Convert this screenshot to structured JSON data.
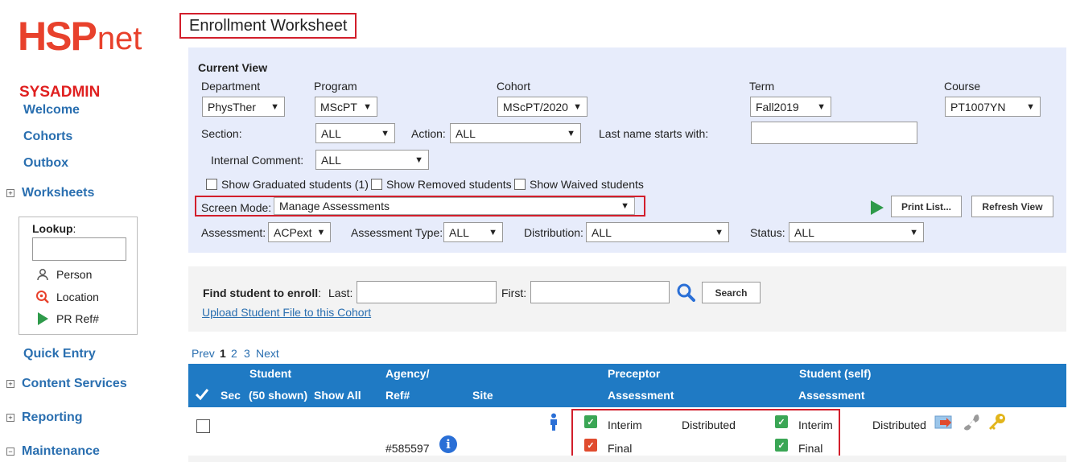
{
  "logo": {
    "hsp": "HSP",
    "net": "net"
  },
  "sidebar": {
    "user": "SYSADMIN",
    "links": {
      "welcome": "Welcome",
      "cohorts": "Cohorts",
      "outbox": "Outbox",
      "quick_entry": "Quick Entry"
    },
    "sections": {
      "worksheets": "Worksheets",
      "content_services": "Content Services",
      "reporting": "Reporting",
      "maintenance": "Maintenance"
    },
    "lookup": {
      "label": "Lookup",
      "person": "Person",
      "location": "Location",
      "pr_ref": "PR Ref#"
    }
  },
  "page": {
    "title": "Enrollment Worksheet"
  },
  "view": {
    "heading": "Current View",
    "department": {
      "label": "Department",
      "value": "PhysTher"
    },
    "program": {
      "label": "Program",
      "value": "MScPT"
    },
    "cohort": {
      "label": "Cohort",
      "value": "MScPT/2020"
    },
    "term": {
      "label": "Term",
      "value": "Fall2019"
    },
    "course": {
      "label": "Course",
      "value": "PT1007YN"
    },
    "section": {
      "label": "Section:",
      "value": "ALL"
    },
    "action": {
      "label": "Action:",
      "value": "ALL"
    },
    "lastname": {
      "label": "Last name starts with:",
      "value": ""
    },
    "internal_comment": {
      "label": "Internal Comment:",
      "value": "ALL"
    },
    "show_graduated": "Show Graduated students (1)",
    "show_removed": "Show Removed students",
    "show_waived": "Show Waived students",
    "screen_mode": {
      "label": "Screen Mode:",
      "value": "Manage Assessments"
    },
    "print_label": "Print List...",
    "refresh_label": "Refresh View",
    "assessment": {
      "label": "Assessment:",
      "value": "ACPext"
    },
    "assessment_type": {
      "label": "Assessment Type:",
      "value": "ALL"
    },
    "distribution": {
      "label": "Distribution:",
      "value": "ALL"
    },
    "status": {
      "label": "Status:",
      "value": "ALL"
    }
  },
  "find": {
    "label": "Find student to enroll",
    "last_label": "Last:",
    "first_label": "First:",
    "search_label": "Search",
    "upload_link": "Upload Student File to this Cohort"
  },
  "pager": {
    "prev": "Prev",
    "p1": "1",
    "p2": "2",
    "p3": "3",
    "next": "Next"
  },
  "table": {
    "headers": {
      "sec": "Sec",
      "student": "Student",
      "shown": "(50 shown)",
      "show_all": "Show All",
      "agency": "Agency/",
      "ref": "Ref#",
      "site": "Site",
      "preceptor": "Preceptor",
      "preceptor_assess": "Assessment",
      "student_self": "Student (self)",
      "student_assess": "Assessment"
    },
    "rows": [
      {
        "ref": "#585597",
        "preceptor_interim": "Interim",
        "preceptor_interim_status": "Distributed",
        "preceptor_final": "Final",
        "student_interim": "Interim",
        "student_interim_status": "Distributed",
        "student_final": "Final"
      }
    ]
  },
  "colors": {
    "accent": "#1f7ac4",
    "brand": "#e8412c",
    "highlight": "#d21e2b",
    "ok": "#3aa655",
    "bad": "#e04b2e"
  }
}
